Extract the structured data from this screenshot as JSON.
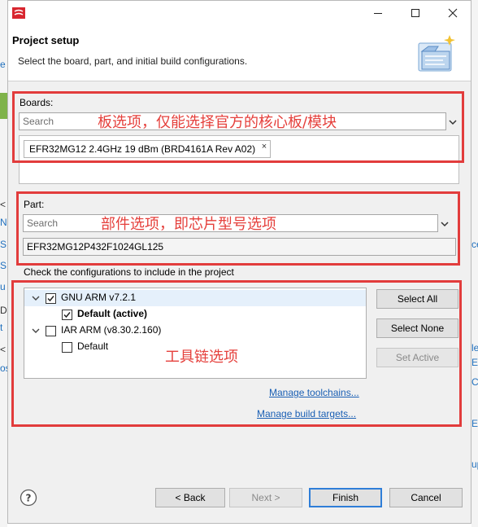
{
  "window": {
    "header_title": "Project setup",
    "header_desc": "Select the board, part, and initial build configurations."
  },
  "background_app": {
    "left_fragments": [
      "e",
      "<",
      "N",
      "S",
      "S",
      "u",
      "D",
      "t",
      "<",
      "os"
    ],
    "right_fragments": [
      "ce",
      "le",
      "E",
      "Co",
      "Ex",
      "up"
    ]
  },
  "boards": {
    "label": "Boards:",
    "search_placeholder": "Search",
    "selected_chip": "EFR32MG12 2.4GHz 19 dBm (BRD4161A Rev A02)",
    "annotation": "板选项，仅能选择官方的核心板/模块"
  },
  "part": {
    "label": "Part:",
    "search_placeholder": "Search",
    "value": "EFR32MG12P432F1024GL125",
    "annotation": "部件选项，即芯片型号选项"
  },
  "configs": {
    "label": "Check the configurations to include in the project",
    "annotation": "工具链选项",
    "tree": [
      {
        "label": "GNU ARM v7.2.1",
        "checked": true,
        "expanded": true
      },
      {
        "label": "Default (active)",
        "checked": true
      },
      {
        "label": "IAR ARM (v8.30.2.160)",
        "checked": false,
        "expanded": true
      },
      {
        "label": "Default",
        "checked": false
      }
    ],
    "buttons": {
      "select_all": "Select All",
      "select_none": "Select None",
      "set_active": "Set Active"
    },
    "links": {
      "manage_toolchains": "Manage toolchains...",
      "manage_build_targets": "Manage build targets..."
    }
  },
  "footer": {
    "back": "< Back",
    "next": "Next >",
    "finish": "Finish",
    "cancel": "Cancel"
  },
  "colors": {
    "annotation_red": "#e23c3c",
    "link_blue": "#1a5fb4",
    "default_button_border": "#2f7ed8"
  }
}
